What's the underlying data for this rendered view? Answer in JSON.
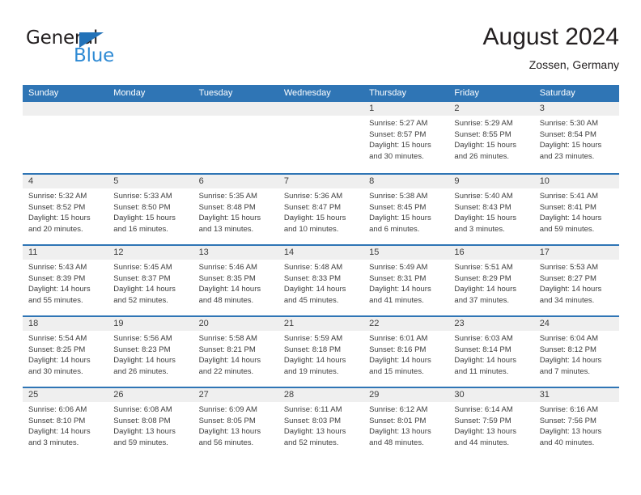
{
  "brand": {
    "word_top": "General",
    "word_bottom": "Blue",
    "triangle_color": "#2272b8",
    "blue_text_color": "#2e8ad4"
  },
  "header": {
    "title": "August 2024",
    "subtitle": "Zossen, Germany"
  },
  "theme": {
    "header_blue": "#2f75b5",
    "day_band_gray": "#efefef",
    "text_color": "#3d3d3d"
  },
  "weekdays": [
    "Sunday",
    "Monday",
    "Tuesday",
    "Wednesday",
    "Thursday",
    "Friday",
    "Saturday"
  ],
  "weeks": [
    [
      {
        "day": "",
        "lines": []
      },
      {
        "day": "",
        "lines": []
      },
      {
        "day": "",
        "lines": []
      },
      {
        "day": "",
        "lines": []
      },
      {
        "day": "1",
        "lines": [
          "Sunrise: 5:27 AM",
          "Sunset: 8:57 PM",
          "Daylight: 15 hours",
          "and 30 minutes."
        ]
      },
      {
        "day": "2",
        "lines": [
          "Sunrise: 5:29 AM",
          "Sunset: 8:55 PM",
          "Daylight: 15 hours",
          "and 26 minutes."
        ]
      },
      {
        "day": "3",
        "lines": [
          "Sunrise: 5:30 AM",
          "Sunset: 8:54 PM",
          "Daylight: 15 hours",
          "and 23 minutes."
        ]
      }
    ],
    [
      {
        "day": "4",
        "lines": [
          "Sunrise: 5:32 AM",
          "Sunset: 8:52 PM",
          "Daylight: 15 hours",
          "and 20 minutes."
        ]
      },
      {
        "day": "5",
        "lines": [
          "Sunrise: 5:33 AM",
          "Sunset: 8:50 PM",
          "Daylight: 15 hours",
          "and 16 minutes."
        ]
      },
      {
        "day": "6",
        "lines": [
          "Sunrise: 5:35 AM",
          "Sunset: 8:48 PM",
          "Daylight: 15 hours",
          "and 13 minutes."
        ]
      },
      {
        "day": "7",
        "lines": [
          "Sunrise: 5:36 AM",
          "Sunset: 8:47 PM",
          "Daylight: 15 hours",
          "and 10 minutes."
        ]
      },
      {
        "day": "8",
        "lines": [
          "Sunrise: 5:38 AM",
          "Sunset: 8:45 PM",
          "Daylight: 15 hours",
          "and 6 minutes."
        ]
      },
      {
        "day": "9",
        "lines": [
          "Sunrise: 5:40 AM",
          "Sunset: 8:43 PM",
          "Daylight: 15 hours",
          "and 3 minutes."
        ]
      },
      {
        "day": "10",
        "lines": [
          "Sunrise: 5:41 AM",
          "Sunset: 8:41 PM",
          "Daylight: 14 hours",
          "and 59 minutes."
        ]
      }
    ],
    [
      {
        "day": "11",
        "lines": [
          "Sunrise: 5:43 AM",
          "Sunset: 8:39 PM",
          "Daylight: 14 hours",
          "and 55 minutes."
        ]
      },
      {
        "day": "12",
        "lines": [
          "Sunrise: 5:45 AM",
          "Sunset: 8:37 PM",
          "Daylight: 14 hours",
          "and 52 minutes."
        ]
      },
      {
        "day": "13",
        "lines": [
          "Sunrise: 5:46 AM",
          "Sunset: 8:35 PM",
          "Daylight: 14 hours",
          "and 48 minutes."
        ]
      },
      {
        "day": "14",
        "lines": [
          "Sunrise: 5:48 AM",
          "Sunset: 8:33 PM",
          "Daylight: 14 hours",
          "and 45 minutes."
        ]
      },
      {
        "day": "15",
        "lines": [
          "Sunrise: 5:49 AM",
          "Sunset: 8:31 PM",
          "Daylight: 14 hours",
          "and 41 minutes."
        ]
      },
      {
        "day": "16",
        "lines": [
          "Sunrise: 5:51 AM",
          "Sunset: 8:29 PM",
          "Daylight: 14 hours",
          "and 37 minutes."
        ]
      },
      {
        "day": "17",
        "lines": [
          "Sunrise: 5:53 AM",
          "Sunset: 8:27 PM",
          "Daylight: 14 hours",
          "and 34 minutes."
        ]
      }
    ],
    [
      {
        "day": "18",
        "lines": [
          "Sunrise: 5:54 AM",
          "Sunset: 8:25 PM",
          "Daylight: 14 hours",
          "and 30 minutes."
        ]
      },
      {
        "day": "19",
        "lines": [
          "Sunrise: 5:56 AM",
          "Sunset: 8:23 PM",
          "Daylight: 14 hours",
          "and 26 minutes."
        ]
      },
      {
        "day": "20",
        "lines": [
          "Sunrise: 5:58 AM",
          "Sunset: 8:21 PM",
          "Daylight: 14 hours",
          "and 22 minutes."
        ]
      },
      {
        "day": "21",
        "lines": [
          "Sunrise: 5:59 AM",
          "Sunset: 8:18 PM",
          "Daylight: 14 hours",
          "and 19 minutes."
        ]
      },
      {
        "day": "22",
        "lines": [
          "Sunrise: 6:01 AM",
          "Sunset: 8:16 PM",
          "Daylight: 14 hours",
          "and 15 minutes."
        ]
      },
      {
        "day": "23",
        "lines": [
          "Sunrise: 6:03 AM",
          "Sunset: 8:14 PM",
          "Daylight: 14 hours",
          "and 11 minutes."
        ]
      },
      {
        "day": "24",
        "lines": [
          "Sunrise: 6:04 AM",
          "Sunset: 8:12 PM",
          "Daylight: 14 hours",
          "and 7 minutes."
        ]
      }
    ],
    [
      {
        "day": "25",
        "lines": [
          "Sunrise: 6:06 AM",
          "Sunset: 8:10 PM",
          "Daylight: 14 hours",
          "and 3 minutes."
        ]
      },
      {
        "day": "26",
        "lines": [
          "Sunrise: 6:08 AM",
          "Sunset: 8:08 PM",
          "Daylight: 13 hours",
          "and 59 minutes."
        ]
      },
      {
        "day": "27",
        "lines": [
          "Sunrise: 6:09 AM",
          "Sunset: 8:05 PM",
          "Daylight: 13 hours",
          "and 56 minutes."
        ]
      },
      {
        "day": "28",
        "lines": [
          "Sunrise: 6:11 AM",
          "Sunset: 8:03 PM",
          "Daylight: 13 hours",
          "and 52 minutes."
        ]
      },
      {
        "day": "29",
        "lines": [
          "Sunrise: 6:12 AM",
          "Sunset: 8:01 PM",
          "Daylight: 13 hours",
          "and 48 minutes."
        ]
      },
      {
        "day": "30",
        "lines": [
          "Sunrise: 6:14 AM",
          "Sunset: 7:59 PM",
          "Daylight: 13 hours",
          "and 44 minutes."
        ]
      },
      {
        "day": "31",
        "lines": [
          "Sunrise: 6:16 AM",
          "Sunset: 7:56 PM",
          "Daylight: 13 hours",
          "and 40 minutes."
        ]
      }
    ]
  ]
}
